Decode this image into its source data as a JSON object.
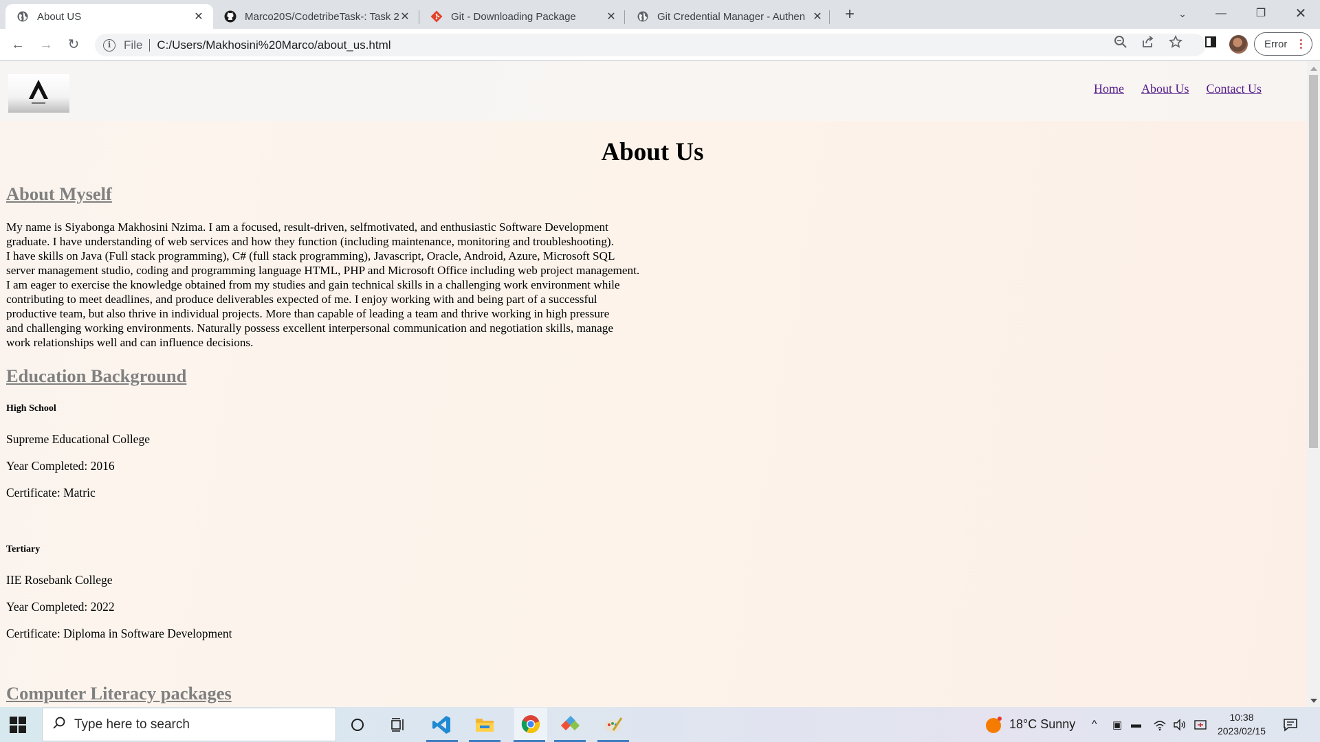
{
  "browser": {
    "tabs": [
      {
        "title": "About US",
        "icon": "globe-icon",
        "active": true
      },
      {
        "title": "Marco20S/CodetribeTask-: Task 2",
        "icon": "github-icon",
        "active": false
      },
      {
        "title": "Git - Downloading Package",
        "icon": "git-icon",
        "active": false
      },
      {
        "title": "Git Credential Manager - Authen",
        "icon": "globe-icon",
        "active": false
      }
    ],
    "address": {
      "scheme_label": "File",
      "url": "C:/Users/Makhosini%20Marco/about_us.html"
    },
    "error_label": "Error"
  },
  "page": {
    "nav": {
      "home": "Home",
      "about": "About Us",
      "contact": "Contact Us"
    },
    "title": "About Us",
    "about_heading": "About Myself",
    "bio_lines": [
      "My name is Siyabonga Makhosini Nzima. I am a focused, result-driven, selfmotivated, and enthusiastic Software Development",
      "graduate. I have understanding of web services and how they function (including maintenance, monitoring and troubleshooting).",
      "I have skills on Java (Full stack programming), C# (full stack programming), Javascript, Oracle, Android, Azure, Microsoft SQL",
      "server management studio, coding and programming language HTML, PHP and Microsoft Office including web project management.",
      "I am eager to exercise the knowledge obtained from my studies and gain technical skills in a challenging work environment while",
      "contributing to meet deadlines, and produce deliverables expected of me. I enjoy working with and being part of a successful",
      "productive team, but also thrive in individual projects. More than capable of leading a team and thrive working in high pressure",
      "and challenging working environments. Naturally possess excellent interpersonal communication and negotiation skills, manage",
      "work relationships well and can influence decisions."
    ],
    "education_heading": "Education Background",
    "high_school": {
      "label": "High School",
      "institution": "Supreme Educational College",
      "year": "Year Completed: 2016",
      "certificate": "Certificate: Matric"
    },
    "tertiary": {
      "label": "Tertiary",
      "institution": "IIE Rosebank College",
      "year": "Year Completed: 2022",
      "certificate": "Certificate: Diploma in Software Development"
    },
    "computer_heading": "Computer Literacy packages"
  },
  "taskbar": {
    "search_placeholder": "Type here to search",
    "weather": "18°C  Sunny",
    "time": "10:38",
    "date": "2023/02/15"
  }
}
